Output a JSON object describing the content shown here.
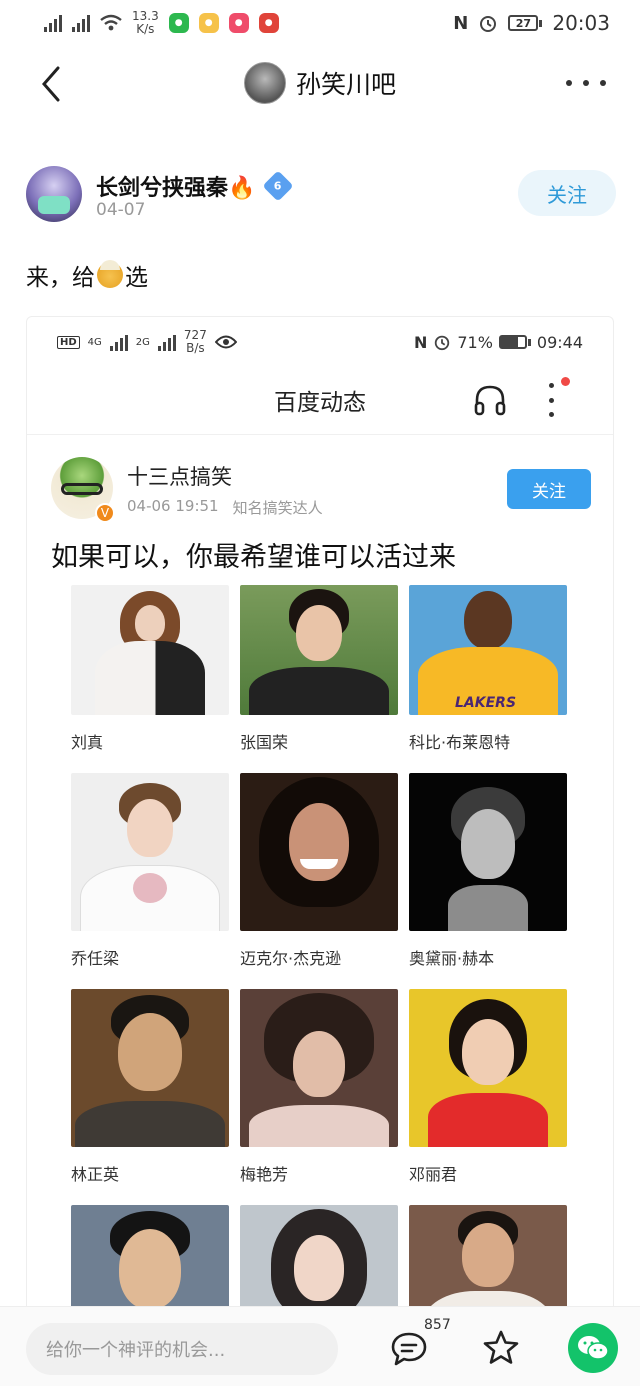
{
  "status_bar": {
    "speed_value": "13.3",
    "speed_unit": "K/s",
    "battery": "27",
    "time": "20:03"
  },
  "header": {
    "forum_name": "孙笑川吧"
  },
  "post": {
    "author_name": "长剑兮挟强秦🔥",
    "level_badge": "6",
    "date": "04-07",
    "follow_label": "关注",
    "text_before": "来，给",
    "text_after": "选"
  },
  "embedded": {
    "status": {
      "speed_value": "727",
      "speed_unit": "B/s",
      "net1": "4G",
      "net2": "2G",
      "battery_percent": "71%",
      "time": "09:44"
    },
    "title": "百度动态",
    "author_name": "十三点搞笑",
    "author_time": "04-06 19:51",
    "author_tag": "知名搞笑达人",
    "follow_label": "关注",
    "v_badge": "V",
    "question": "如果可以，你最希望谁可以活过来",
    "people": [
      {
        "name": "刘真"
      },
      {
        "name": "张国荣"
      },
      {
        "name": "科比·布莱恩特"
      },
      {
        "name": "乔任梁"
      },
      {
        "name": "迈克尔·杰克逊"
      },
      {
        "name": "奥黛丽·赫本"
      },
      {
        "name": "林正英"
      },
      {
        "name": "梅艳芳"
      },
      {
        "name": "邓丽君"
      },
      {
        "name": ""
      },
      {
        "name": ""
      },
      {
        "name": ""
      }
    ],
    "jersey_text": "LAKERS"
  },
  "bottom_bar": {
    "comment_placeholder": "给你一个神评的机会...",
    "comment_count": "857"
  },
  "colors": {
    "accent_blue": "#3aa0ee",
    "follow_light_bg": "#eaf5fb",
    "wechat_green": "#13c36a"
  },
  "icons": [
    "back-arrow-icon",
    "more-dots-icon",
    "fire-icon",
    "level-badge-icon",
    "headphone-icon",
    "comment-icon",
    "star-icon",
    "wechat-icon"
  ]
}
